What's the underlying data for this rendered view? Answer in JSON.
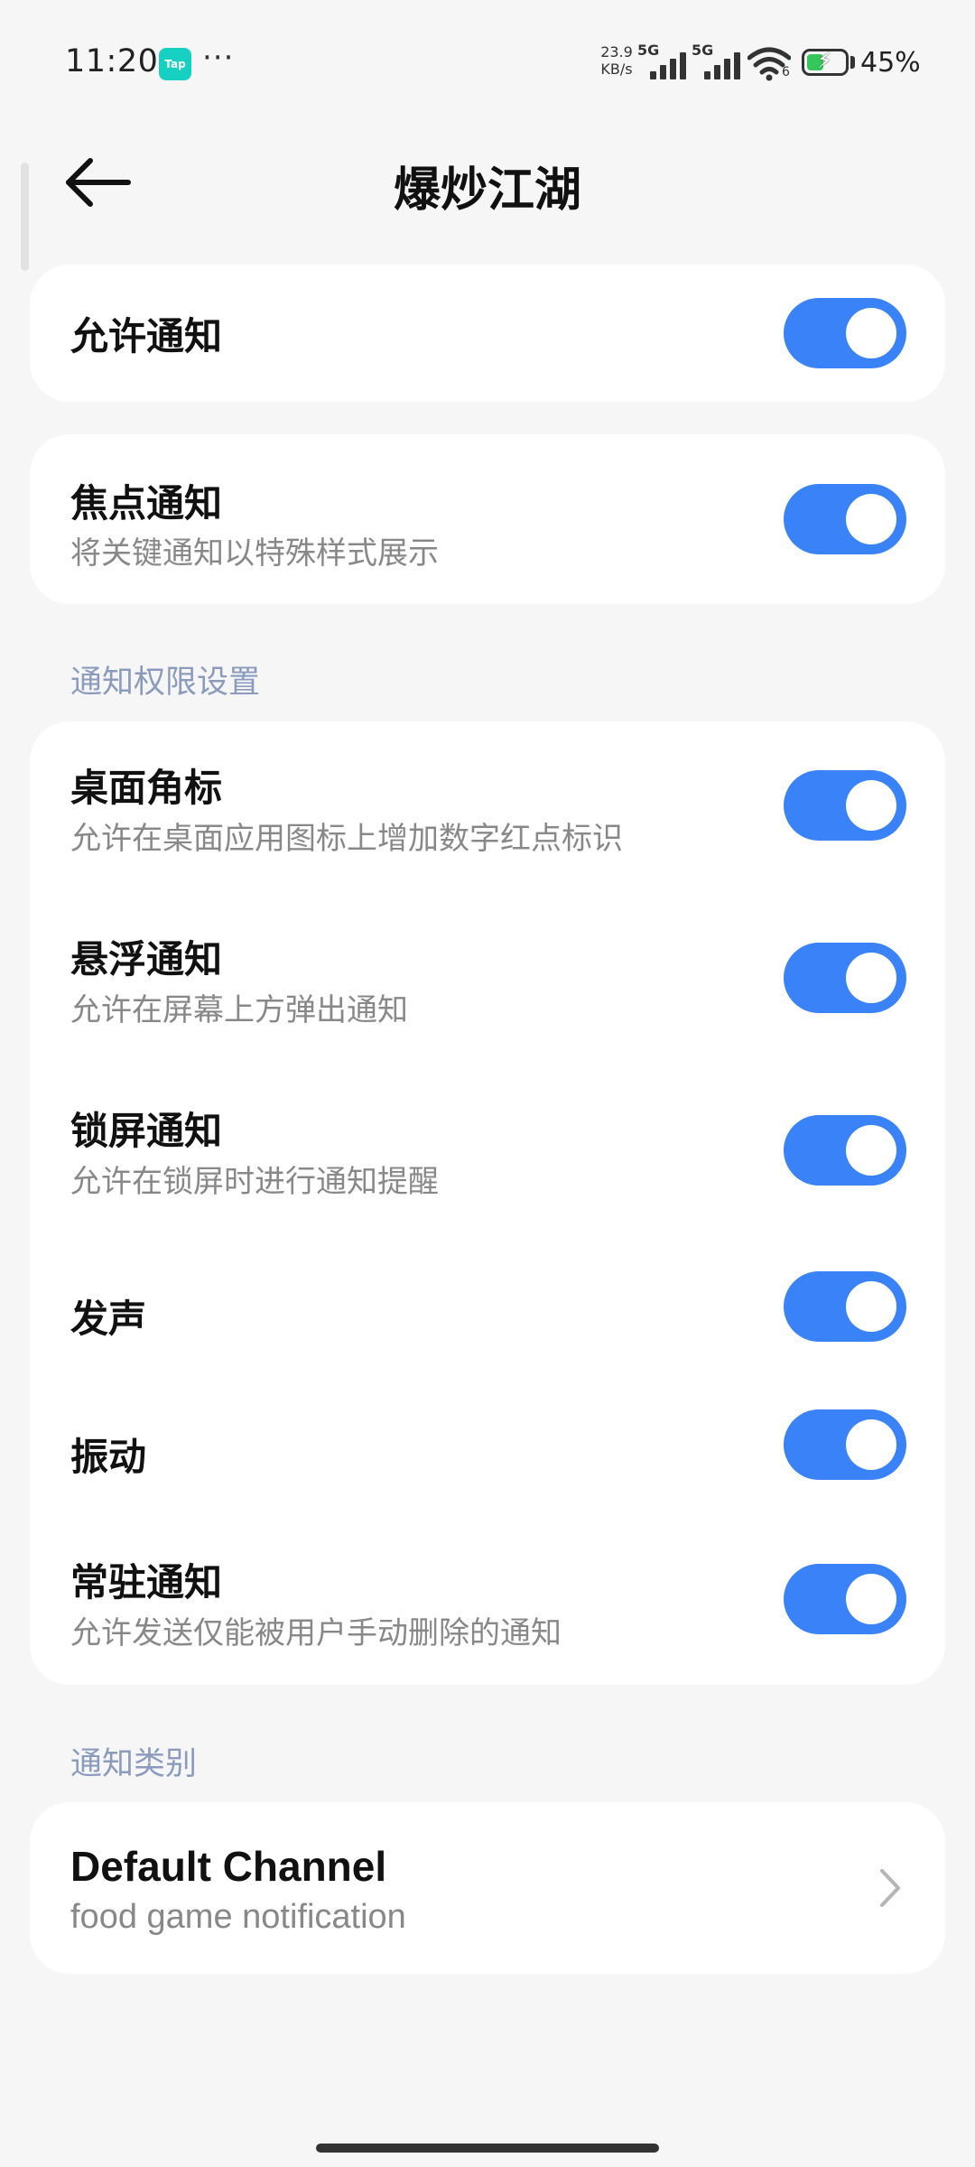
{
  "status_bar": {
    "time": "11:20",
    "app_badge": "Tap",
    "more": "···",
    "net_speed_value": "23.9",
    "net_speed_unit": "KB/s",
    "sim1": "5G",
    "sim2": "5G",
    "wifi_label": "6",
    "battery_percent": "45%",
    "battery_level": 0.45,
    "charging": true
  },
  "header": {
    "title": "爆炒江湖",
    "back_icon": "arrow-left-icon"
  },
  "allow_notification": {
    "title": "允许通知",
    "enabled": true
  },
  "focus_notification": {
    "title": "焦点通知",
    "subtitle": "将关键通知以特殊样式展示",
    "enabled": true
  },
  "permissions": {
    "header": "通知权限设置",
    "items": [
      {
        "title": "桌面角标",
        "subtitle": "允许在桌面应用图标上增加数字红点标识",
        "enabled": true
      },
      {
        "title": "悬浮通知",
        "subtitle": "允许在屏幕上方弹出通知",
        "enabled": true
      },
      {
        "title": "锁屏通知",
        "subtitle": "允许在锁屏时进行通知提醒",
        "enabled": true
      },
      {
        "title": "发声",
        "subtitle": "",
        "enabled": true
      },
      {
        "title": "振动",
        "subtitle": "",
        "enabled": true
      },
      {
        "title": "常驻通知",
        "subtitle": "允许发送仅能被用户手动删除的通知",
        "enabled": true
      }
    ]
  },
  "categories": {
    "header": "通知类别",
    "channel": {
      "title": "Default Channel",
      "subtitle": "food game notification",
      "icon": "chevron-right-icon"
    }
  },
  "colors": {
    "toggle_on": "#3a82f7",
    "section_header": "#8a9bbd",
    "background": "#f6f6f6"
  }
}
